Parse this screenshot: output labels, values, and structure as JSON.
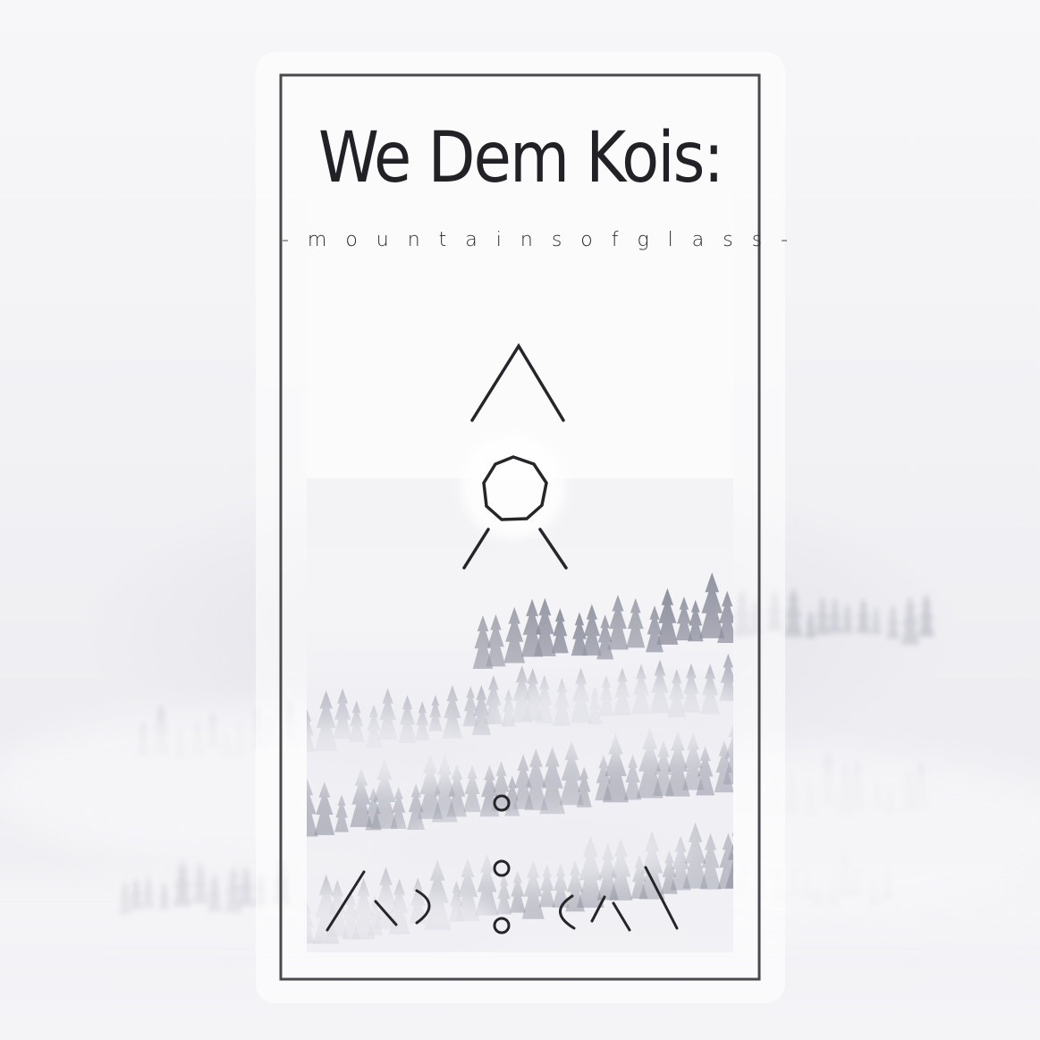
{
  "cover": {
    "title": "We Dem Kois:",
    "subtitle": "- m o u n t a i n s  o f  g l a s s -"
  },
  "colors": {
    "ink": "#222226",
    "frame": "#4a4a4e",
    "mist": "#eeeef2",
    "trees": "#5a5d70"
  },
  "icons": [
    "mountain-peak-icon",
    "circle-peak-icon",
    "dots-icon",
    "rune-glyphs-icon"
  ]
}
